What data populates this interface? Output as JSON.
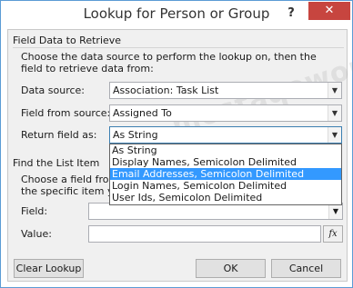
{
  "window": {
    "title": "Lookup for Person or Group",
    "help_label": "?",
    "close_label": "✕"
  },
  "field_data": {
    "section_title": "Field Data to Retrieve",
    "description": "Choose the data source to perform the lookup on, then the field to retrieve data from:",
    "data_source_label": "Data source:",
    "data_source_value": "Association: Task List",
    "field_from_source_label": "Field from source:",
    "field_from_source_value": "Assigned To",
    "return_field_label": "Return field as:",
    "return_field_value": "As String",
    "return_field_options": [
      "As String",
      "Display Names, Semicolon Delimited",
      "Email Addresses, Semicolon Delimited",
      "Login Names, Semicolon Delimited",
      "User Ids, Semicolon Delimited"
    ],
    "selected_option_index": 2
  },
  "find_list_item": {
    "section_title": "Find the List Item",
    "description_line1": "Choose a field from",
    "description_line2": "the specific item you",
    "field_label": "Field:",
    "value_label": "Value:",
    "fx_label": "fx"
  },
  "buttons": {
    "clear_lookup": "Clear Lookup",
    "ok": "OK",
    "cancel": "Cancel"
  },
  "watermark": "mostaqoworx"
}
